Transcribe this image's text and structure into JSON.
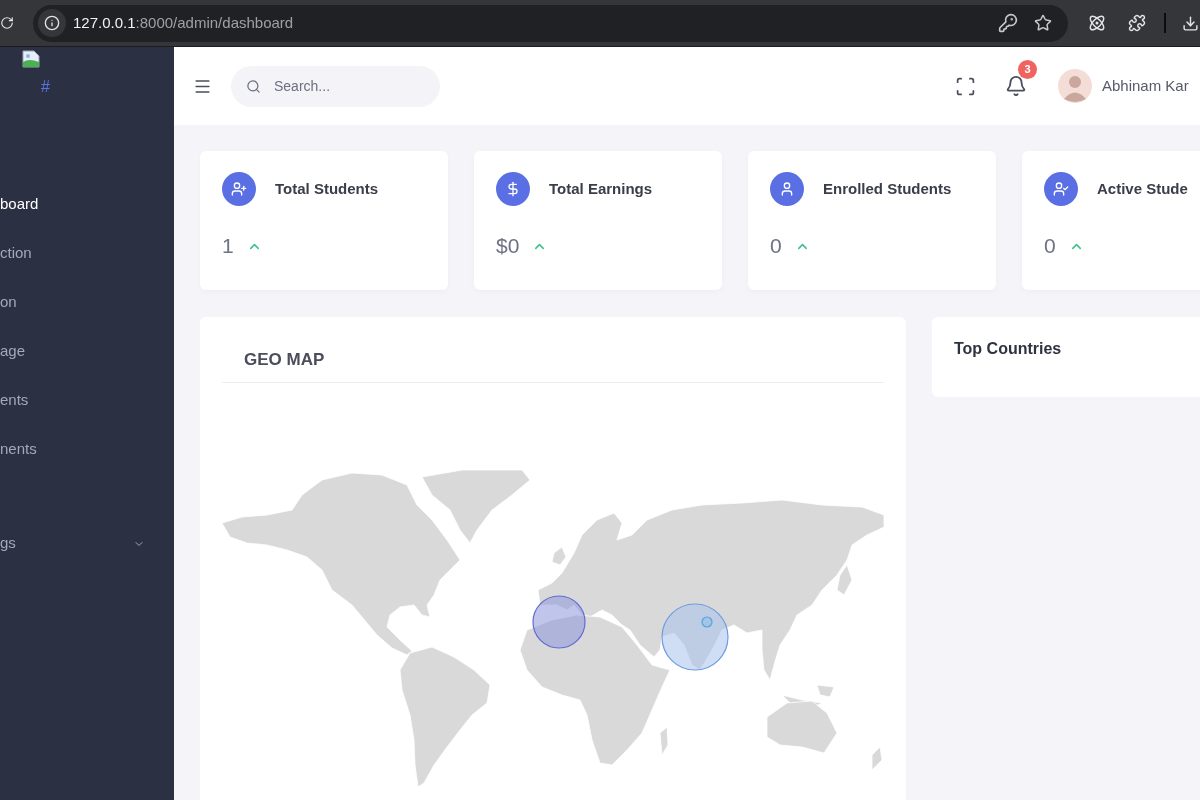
{
  "browser": {
    "url_host": "127.0.0.1",
    "url_path": ":8000/admin/dashboard"
  },
  "sidebar": {
    "logo_text": "#",
    "items": [
      {
        "label": "board",
        "kind": "link",
        "selected": true
      },
      {
        "label": "ction",
        "kind": "link",
        "selected": false
      },
      {
        "label": "on",
        "kind": "link",
        "selected": false
      },
      {
        "label": "age",
        "kind": "link",
        "selected": false
      },
      {
        "label": "ents",
        "kind": "link",
        "selected": false
      },
      {
        "label": "nents",
        "kind": "link",
        "selected": false
      },
      {
        "label": "gs",
        "kind": "group",
        "selected": false
      }
    ]
  },
  "header": {
    "search": {
      "placeholder": "Search..."
    },
    "notifications": {
      "count": "3"
    },
    "user": {
      "name": "Abhinam Kar"
    }
  },
  "stat_cards": [
    {
      "title": "Total Students",
      "value": "1",
      "rising": true
    },
    {
      "title": "Total Earnings",
      "value": "$0",
      "rising": true
    },
    {
      "title": "Enrolled Students",
      "value": "0",
      "rising": true
    },
    {
      "title": "Active Stude",
      "value": "0",
      "rising": true
    }
  ],
  "geo_map": {
    "title": "GEO MAP"
  },
  "top_countries": {
    "title": "Top Countries"
  }
}
